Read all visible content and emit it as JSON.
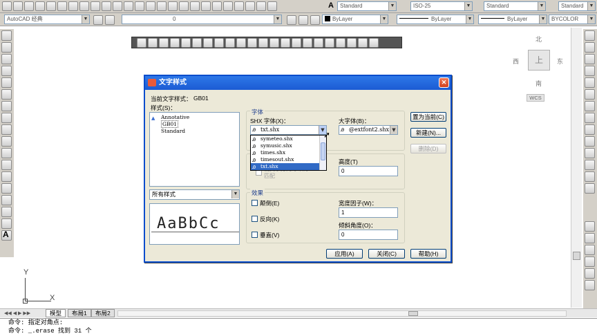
{
  "toolbar_top": {
    "textstyle_combo": "Standard",
    "dimstyle_combo": "ISO-25",
    "tablestyle_combo": "Standard",
    "multileader_combo": "Standard"
  },
  "toolbar_second": {
    "workspace_combo": "AutoCAD 经典",
    "layer_combo": "0",
    "color_combo": "ByLayer",
    "linetype_combo": "ByLayer",
    "lineweight_combo": "ByLayer",
    "plotstyle_combo": "BYCOLOR"
  },
  "viewcube": {
    "north": "北",
    "south": "南",
    "east": "东",
    "west": "西",
    "face": "上",
    "wcs": "WCS"
  },
  "ucs": {
    "x": "X",
    "y": "Y"
  },
  "dialog": {
    "title": "文字样式",
    "current_style_label": "当前文字样式：",
    "current_style_value": "GB01",
    "styles_label": "样式(S)：",
    "styles": [
      "Annotative",
      "GB01",
      "Standard"
    ],
    "style_filter": "所有样式",
    "preview_text": "AaBbCc",
    "font_group": "字体",
    "shx_font_label": "SHX 字体(X)：",
    "shx_font_value": "txt.shx",
    "big_font_label": "大字体(B)：",
    "big_font_value": "@extfont2.shx",
    "font_list": [
      "symeteo.shx",
      "symusic.shx",
      "times.shx",
      "timesout.shx",
      "txt.shx"
    ],
    "obscured_option": "使文字方向与布局匹配",
    "height_label": "高度(T)",
    "height_value": "0",
    "effects_group": "效果",
    "upside_down": "颠倒(E)",
    "backwards": "反向(K)",
    "vertical": "垂直(V)",
    "width_factor_label": "宽度因子(W)：",
    "width_factor_value": "1",
    "oblique_label": "倾斜角度(O)：",
    "oblique_value": "0",
    "set_current_btn": "置为当前(C)",
    "new_btn": "新建(N)...",
    "delete_btn": "删除(D)",
    "apply_btn": "应用(A)",
    "close_btn": "关闭(C)",
    "help_btn": "帮助(H)"
  },
  "layout_tabs": [
    "模型",
    "布局1",
    "布局2"
  ],
  "command": {
    "line1": "命令: 指定对角点:",
    "line2": "命令: _.erase 找到 31 个"
  }
}
